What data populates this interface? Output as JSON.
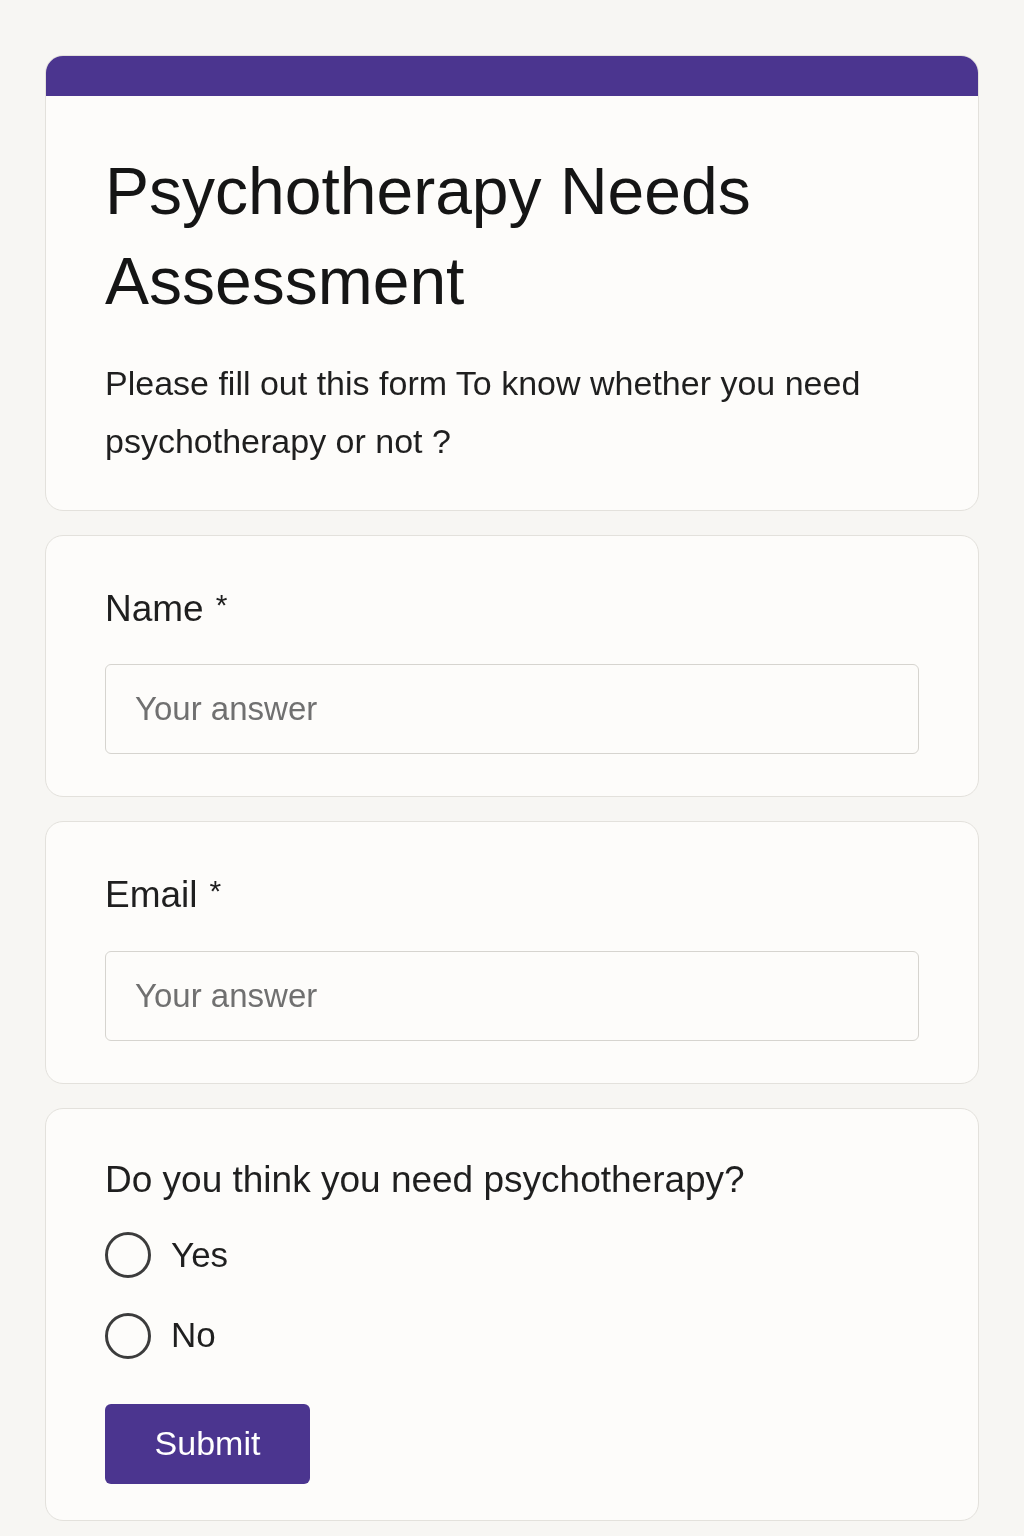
{
  "form": {
    "title": "Psychotherapy Needs Assessment",
    "description": "Please fill out this form To know whether you need psychotherapy or not ?"
  },
  "questions": [
    {
      "kind": "text",
      "label": "Name",
      "required_mark": "*",
      "placeholder": "Your answer"
    },
    {
      "kind": "text",
      "label": "Email",
      "required_mark": "*",
      "placeholder": "Your answer"
    },
    {
      "kind": "radio",
      "label": "Do you think you need psychotherapy?",
      "options": [
        {
          "label": "Yes",
          "selected": false
        },
        {
          "label": "No",
          "selected": false
        }
      ],
      "submit": "Submit"
    }
  ]
}
